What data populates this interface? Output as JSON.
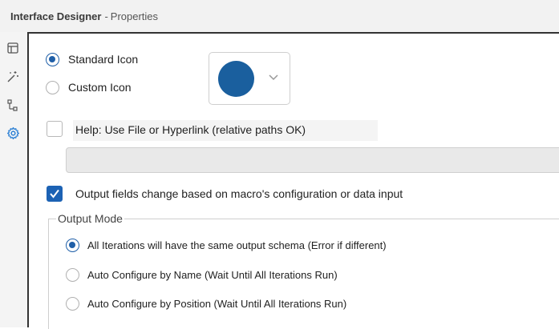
{
  "titlebar": {
    "app_name": "Interface Designer",
    "separator": "-",
    "panel_name": "Properties"
  },
  "sidebar": {
    "items": [
      {
        "icon": "layout-icon",
        "active": false
      },
      {
        "icon": "magic-wand-icon",
        "active": false
      },
      {
        "icon": "tree-icon",
        "active": false
      },
      {
        "icon": "gear-icon",
        "active": true
      }
    ]
  },
  "icon_section": {
    "standard_label": "Standard Icon",
    "custom_label": "Custom Icon",
    "selected": "standard",
    "swatch_color": "#1a5f9e"
  },
  "help": {
    "label": "Help: Use File or Hyperlink (relative paths OK)",
    "checked": false,
    "value": ""
  },
  "output_fields": {
    "label": "Output fields change based on macro's configuration or data input",
    "checked": true
  },
  "output_mode": {
    "legend": "Output Mode",
    "options": [
      {
        "label": "All Iterations will have the same output schema (Error if different)",
        "selected": true
      },
      {
        "label": "Auto Configure by Name (Wait Until All Iterations Run)",
        "selected": false
      },
      {
        "label": "Auto Configure by Position (Wait Until All Iterations Run)",
        "selected": false
      }
    ]
  },
  "colors": {
    "accent": "#1f5fa8",
    "checkbox_fill": "#1c62b4",
    "gear_active": "#2a7fd4"
  }
}
